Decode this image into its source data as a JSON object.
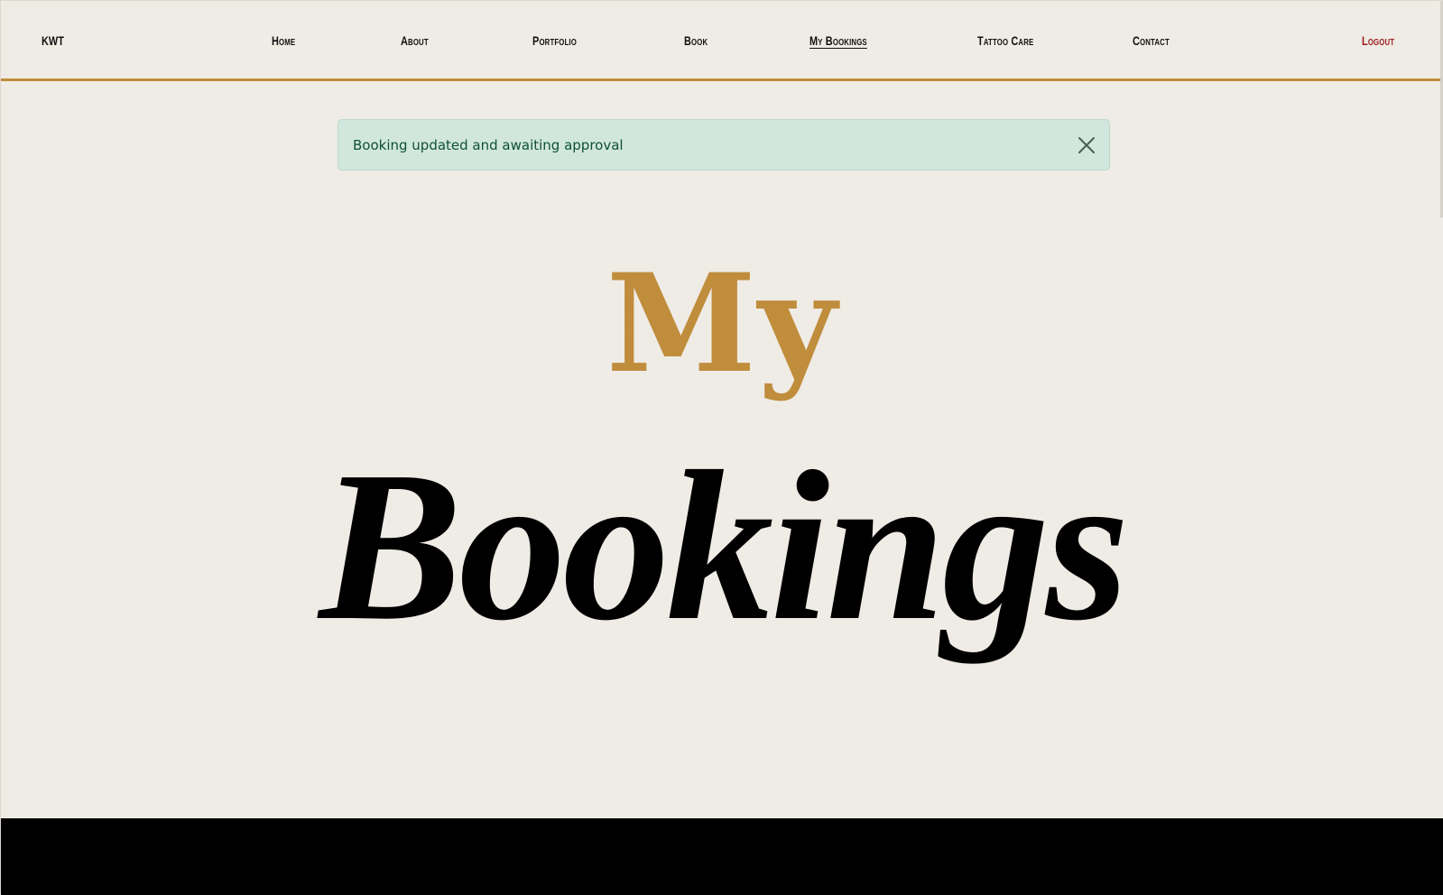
{
  "nav": {
    "brand": "KWT",
    "items": [
      {
        "label": "Home"
      },
      {
        "label": "About"
      },
      {
        "label": "Portfolio"
      },
      {
        "label": "Book"
      },
      {
        "label": "My Bookings"
      },
      {
        "label": "Tattoo Care"
      },
      {
        "label": "Contact"
      }
    ],
    "logout": "Logout",
    "active": "My Bookings"
  },
  "alert": {
    "message": "Booking updated and awaiting approval",
    "close_icon": "close-icon"
  },
  "hero": {
    "title_top": "My",
    "title_bottom": "Bookings"
  },
  "colors": {
    "background": "#efebe5",
    "accent_gold": "#c08d3c",
    "logout_red": "#9c1a1a",
    "alert_bg": "#d1e7dd",
    "alert_text": "#0f5132",
    "footer": "#000000"
  }
}
